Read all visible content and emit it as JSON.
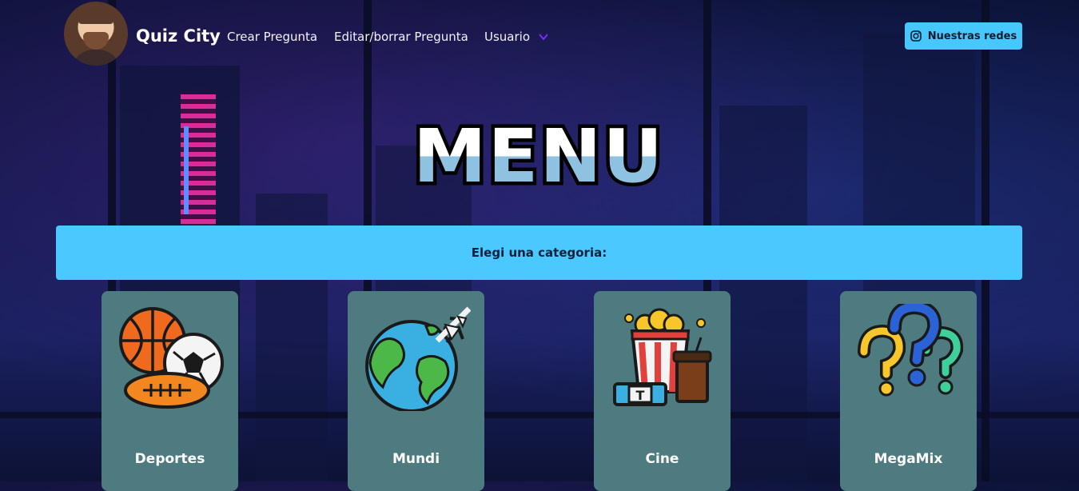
{
  "nav": {
    "brand": "Quiz City",
    "links": [
      "Crear Pregunta",
      "Editar/borrar Pregunta",
      "Usuario"
    ],
    "social_button": "Nuestras redes",
    "avatar_icon": "user-avatar",
    "dropdown_icon": "chevron-down-icon",
    "social_icon": "instagram-icon"
  },
  "hero": {
    "logo_text": "MENU"
  },
  "banner": {
    "text": "Elegi una categoria:"
  },
  "categories": [
    {
      "label": "Deportes",
      "icon": "sports-balls-icon"
    },
    {
      "label": "Mundi",
      "icon": "globe-plane-icon"
    },
    {
      "label": "Cine",
      "icon": "popcorn-ticket-icon"
    },
    {
      "label": "MegaMix",
      "icon": "question-marks-icon"
    }
  ],
  "colors": {
    "accent": "#47c8fd",
    "card": "#4e7b80",
    "chevron": "#7a2cff",
    "background": "#141a4e"
  }
}
